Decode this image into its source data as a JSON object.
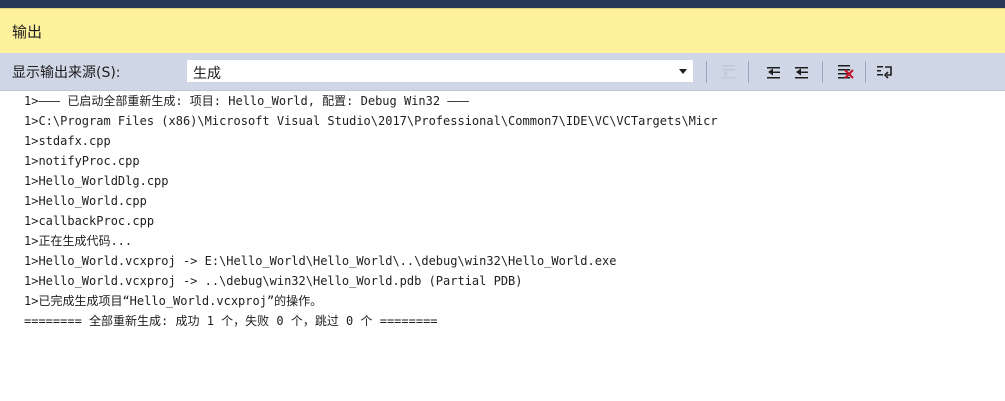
{
  "panel": {
    "title": "输出"
  },
  "toolbar": {
    "source_label": "显示输出来源(S):",
    "source_value": "生成",
    "buttons": [
      {
        "name": "goto-previous-message-icon",
        "enabled": false
      },
      {
        "name": "find-previous-message-icon",
        "enabled": true
      },
      {
        "name": "find-next-message-icon",
        "enabled": true
      },
      {
        "name": "clear-all-icon",
        "enabled": true
      },
      {
        "name": "toggle-word-wrap-icon",
        "enabled": true
      }
    ]
  },
  "output": {
    "lines": [
      "1>——— 已启动全部重新生成: 项目: Hello_World, 配置: Debug Win32 ———",
      "1>C:\\Program Files (x86)\\Microsoft Visual Studio\\2017\\Professional\\Common7\\IDE\\VC\\VCTargets\\Micr",
      "1>stdafx.cpp",
      "1>notifyProc.cpp",
      "1>Hello_WorldDlg.cpp",
      "1>Hello_World.cpp",
      "1>callbackProc.cpp",
      "1>正在生成代码...",
      "1>Hello_World.vcxproj -> E:\\Hello_World\\Hello_World\\..\\debug\\win32\\Hello_World.exe",
      "1>Hello_World.vcxproj -> ..\\debug\\win32\\Hello_World.pdb (Partial PDB)",
      "1>已完成生成项目“Hello_World.vcxproj”的操作。",
      "======== 全部重新生成: 成功 1 个，失败 0 个，跳过 0 个 ========"
    ]
  },
  "colors": {
    "title_bar": "#fff29d",
    "toolbar": "#cfd6e5",
    "top_line": "#293955"
  }
}
